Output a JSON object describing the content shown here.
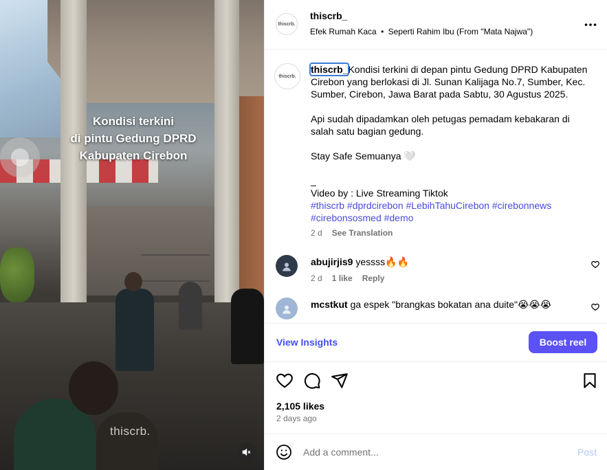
{
  "video": {
    "overlay_line1": "Kondisi terkini",
    "overlay_line2": "di pintu Gedung DPRD",
    "overlay_line3": "Kabupaten Cirebon",
    "watermark": "thiscrb.",
    "mute_icon": "speaker-muted-icon"
  },
  "header": {
    "avatar_text": "thiscrb.",
    "username": "thiscrb_",
    "audio_song": "Efek Rumah Kaca",
    "audio_separator": "•",
    "audio_title": "Seperti Rahim Ibu (From \"Mata Najwa\")",
    "more_icon": "more-horizontal-icon"
  },
  "caption": {
    "avatar_text": "thiscrb.",
    "username": "thiscrb_",
    "para1": "Kondisi terkini di depan pintu Gedung DPRD Kabupaten Cirebon yang berlokasi di Jl. Sunan Kalijaga No.7, Sumber, Kec. Sumber, Cirebon, Jawa Barat pada Sabtu, 30 Agustus 2025.",
    "para2": "Api sudah dipadamkan oleh petugas pemadam kebakaran di salah satu bagian gedung.",
    "para3": "Stay Safe Semuanya 🤍",
    "para4": "_",
    "para5": "Video by : Live Streaming Tiktok",
    "hashtags_line1": "#thiscrb #dprdcirebon #LebihTahuCirebon #cirebonnews",
    "hashtags_line2": "#cirebonsosmed #demo",
    "time": "2 d",
    "see_translation": "See Translation"
  },
  "comments": [
    {
      "username": "abujirjis9",
      "text": "yessss🔥🔥",
      "time": "2 d",
      "likes": "1 like",
      "reply": "Reply",
      "avatar_color": "#2f3b4a"
    },
    {
      "username": "mcstkut",
      "text": "ga espek \"brangkas bokatan ana duite\"😭😭😭",
      "avatar_color": "#9fb6d4"
    }
  ],
  "insights": {
    "view_label": "View Insights",
    "boost_label": "Boost reel"
  },
  "actions": {
    "like_icon": "heart-icon",
    "comment_icon": "comment-icon",
    "share_icon": "send-icon",
    "save_icon": "bookmark-icon",
    "likes": "2,105 likes",
    "ago": "2 days ago"
  },
  "add_comment": {
    "placeholder": "Add a comment...",
    "post_label": "Post",
    "emoji_icon": "emoji-icon"
  }
}
